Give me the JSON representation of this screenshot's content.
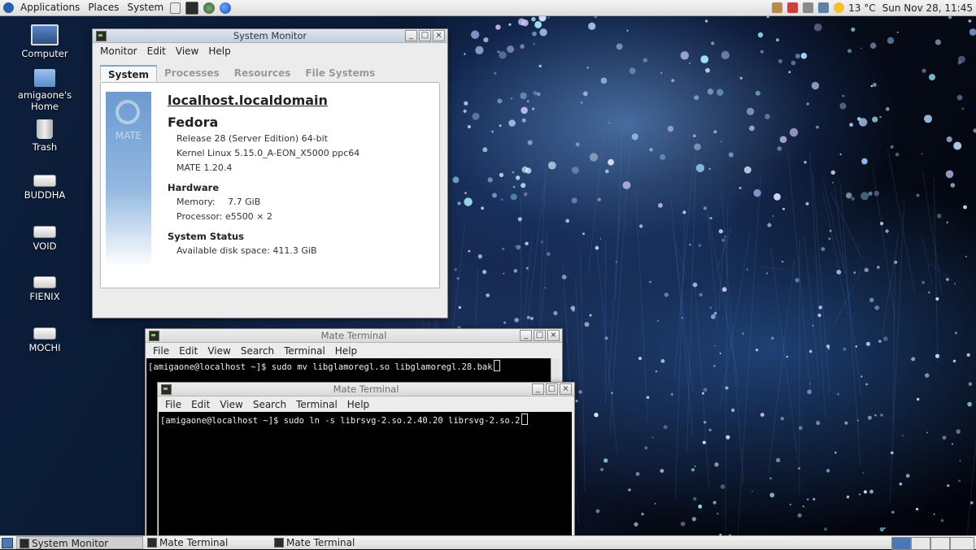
{
  "top_panel": {
    "menus": [
      "Applications",
      "Places",
      "System"
    ],
    "weather": "13 °C",
    "clock": "Sun Nov 28, 11:45"
  },
  "desktop_icons": [
    {
      "label": "Computer",
      "icon": "computer-icon"
    },
    {
      "label": "amigaone's Home",
      "icon": "home-folder-icon"
    },
    {
      "label": "Trash",
      "icon": "trash-icon"
    },
    {
      "label": "BUDDHA",
      "icon": "drive-icon"
    },
    {
      "label": "VOID",
      "icon": "drive-icon"
    },
    {
      "label": "FIENIX",
      "icon": "drive-icon"
    },
    {
      "label": "MOCHI",
      "icon": "drive-icon"
    }
  ],
  "system_monitor": {
    "title": "System Monitor",
    "menus": [
      "Monitor",
      "Edit",
      "View",
      "Help"
    ],
    "tabs": [
      "System",
      "Processes",
      "Resources",
      "File Systems"
    ],
    "active_tab": "System",
    "logo_text": "MATE",
    "hostname": "localhost.localdomain",
    "distro": "Fedora",
    "release": "Release 28 (Server Edition) 64-bit",
    "kernel": "Kernel Linux 5.15.0_A-EON_X5000 ppc64",
    "desktop": "MATE 1.20.4",
    "hardware_heading": "Hardware",
    "memory_label": "Memory:",
    "memory_value": "7.7 GiB",
    "processor_label": "Processor:",
    "processor_value": "e5500 × 2",
    "status_heading": "System Status",
    "disk_label": "Available disk space:",
    "disk_value": "411.3 GiB"
  },
  "terminal_back": {
    "title": "Mate Terminal",
    "menus": [
      "File",
      "Edit",
      "View",
      "Search",
      "Terminal",
      "Help"
    ],
    "line": "[amigaone@localhost ~]$ sudo mv libglamoregl.so libglamoregl.28.bak"
  },
  "terminal_front": {
    "title": "Mate Terminal",
    "menus": [
      "File",
      "Edit",
      "View",
      "Search",
      "Terminal",
      "Help"
    ],
    "line": "[amigaone@localhost ~]$ sudo ln -s librsvg-2.so.2.40.20 librsvg-2.so.2"
  },
  "taskbar": {
    "tasks": [
      "System Monitor",
      "Mate Terminal",
      "Mate Terminal"
    ]
  },
  "colors": {
    "title_active": "#c3cfde",
    "tab_accent": "#7ea7da",
    "terminal_bg": "#000000"
  }
}
